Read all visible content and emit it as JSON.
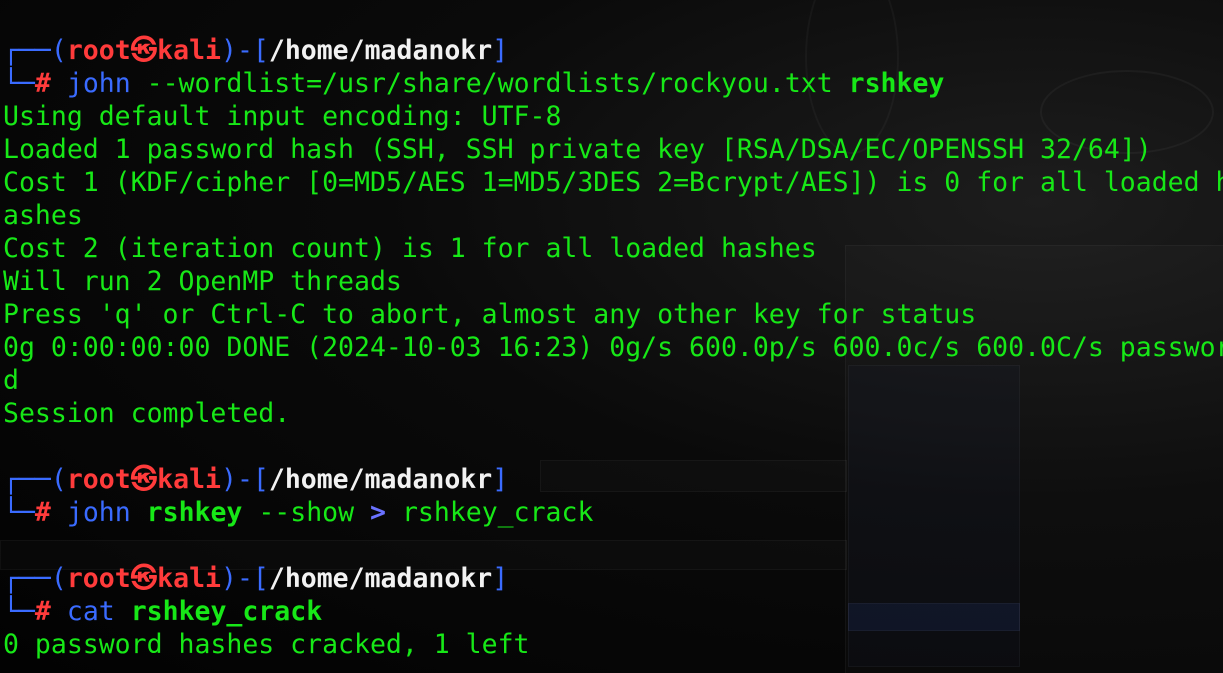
{
  "colors": {
    "output": "#17e817",
    "box": "#3a6bff",
    "user": "#ff3b3b",
    "path": "#f2f2f2",
    "command": "#3a6bff"
  },
  "prompt": {
    "corner_top": "┌──(",
    "user": "root",
    "symbol": "㉿",
    "host": "kali",
    "mid": ")-[",
    "path": "/home/madanokr",
    "end": "]",
    "corner_bottom": "└─",
    "hash": "#"
  },
  "block1": {
    "cmd": "john",
    "args": " --wordlist=/usr/share/wordlists/rockyou.txt ",
    "target": "rshkey",
    "output": [
      "Using default input encoding: UTF-8",
      "Loaded 1 password hash (SSH, SSH private key [RSA/DSA/EC/OPENSSH 32/64])",
      "Cost 1 (KDF/cipher [0=MD5/AES 1=MD5/3DES 2=Bcrypt/AES]) is 0 for all loaded h",
      "ashes",
      "Cost 2 (iteration count) is 1 for all loaded hashes",
      "Will run 2 OpenMP threads",
      "Press 'q' or Ctrl-C to abort, almost any other key for status",
      "0g 0:00:00:00 DONE (2024-10-03 16:23) 0g/s 600.0p/s 600.0c/s 600.0C/s passwor",
      "d",
      "Session completed."
    ]
  },
  "block2": {
    "cmd": "john",
    "target": "rshkey",
    "flag": " --show ",
    "redirect": ">",
    "outfile": " rshkey_crack"
  },
  "block3": {
    "cmd": "cat",
    "target": "rshkey_crack",
    "output": "0 password hashes cracked, 1 left"
  }
}
